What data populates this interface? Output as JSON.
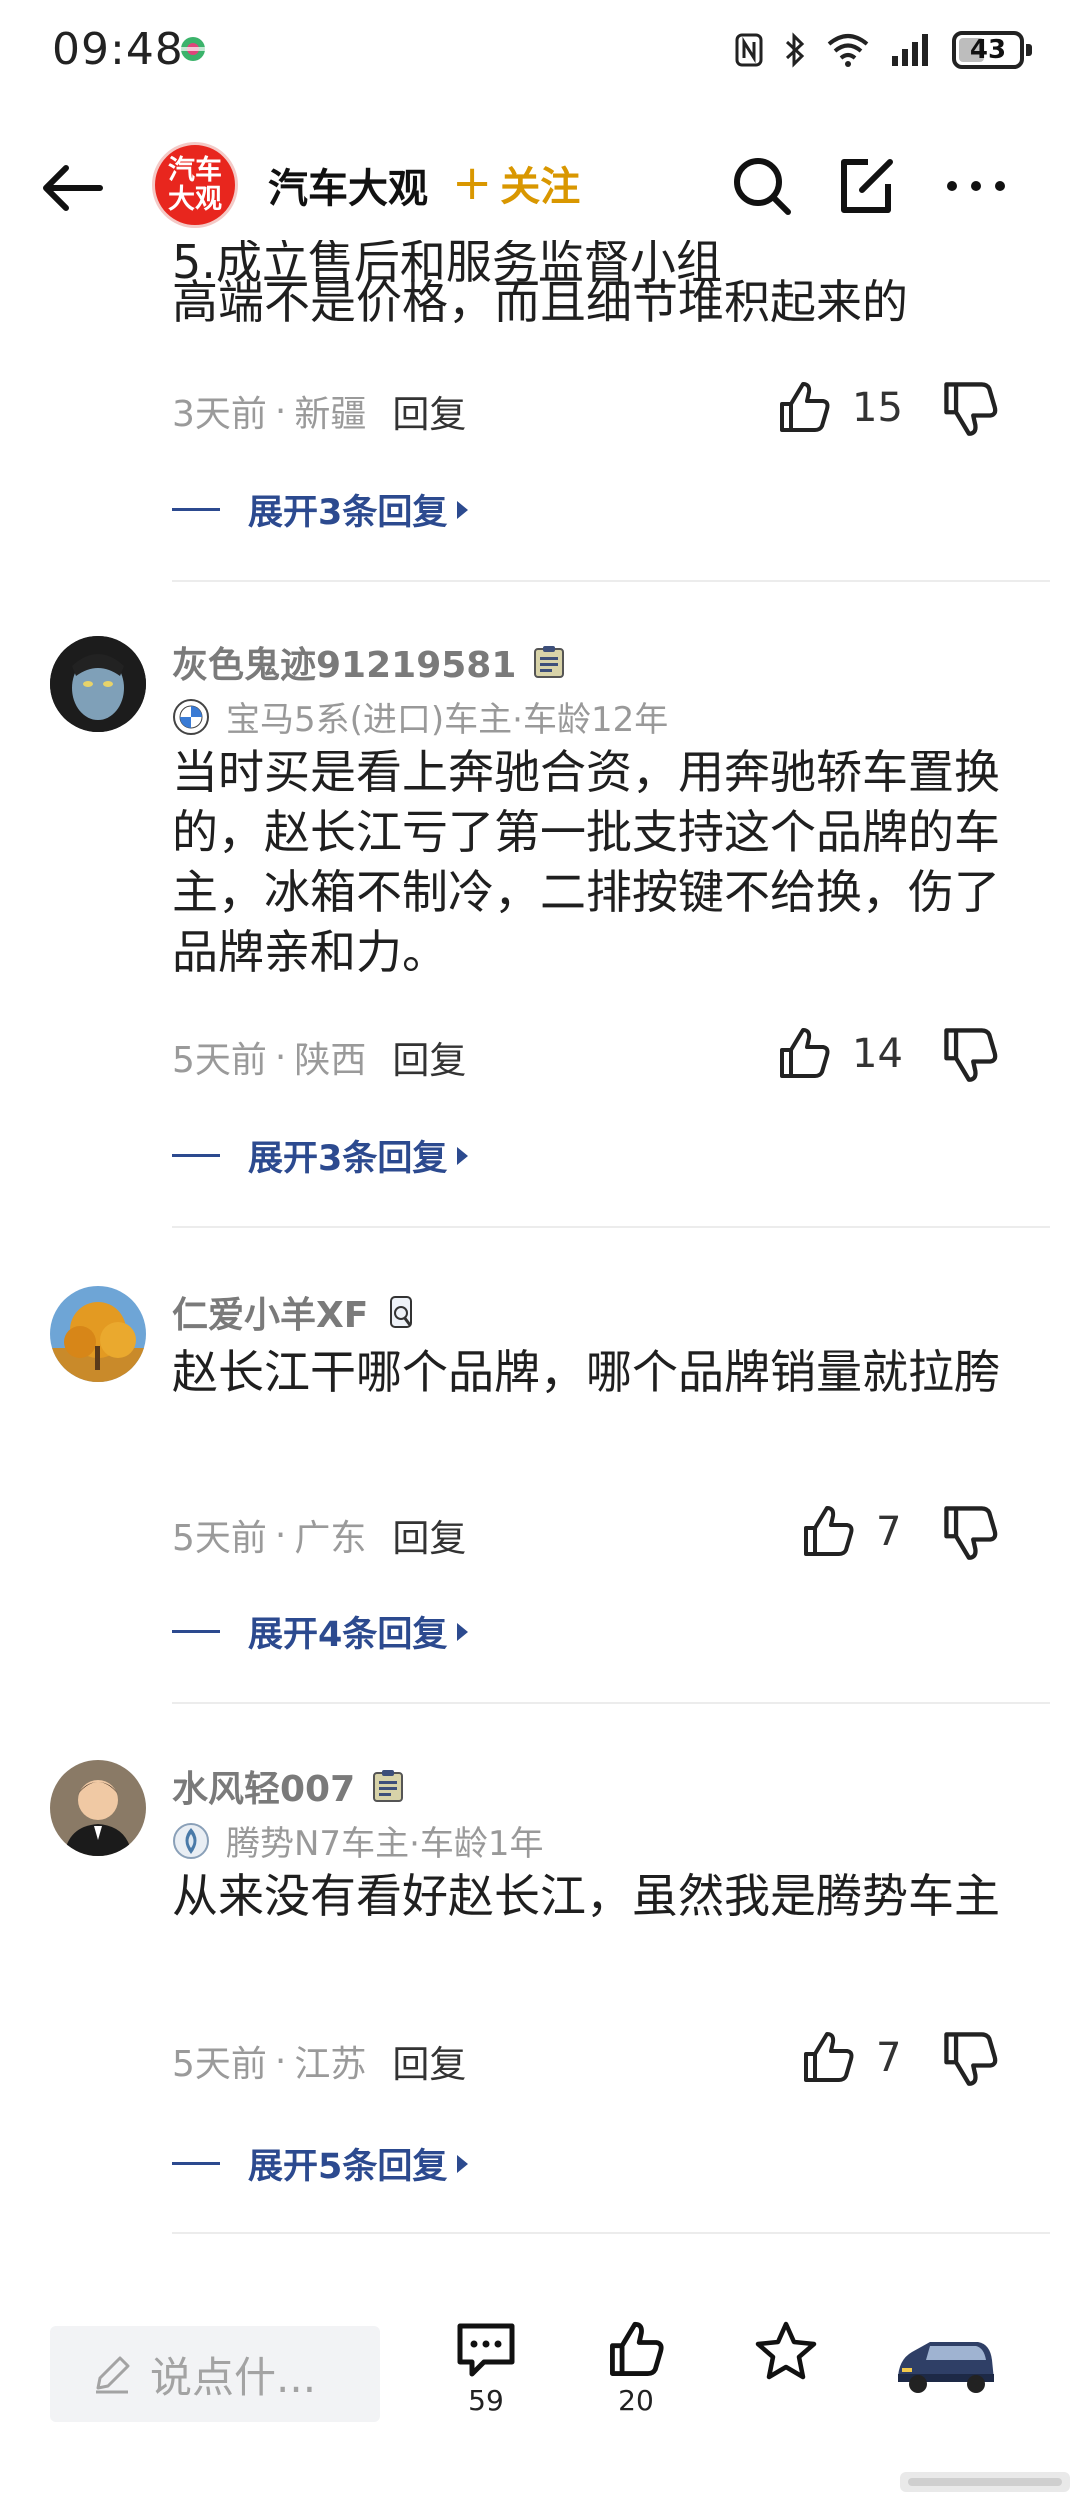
{
  "status_bar": {
    "time": "09:48",
    "battery": "43",
    "battery_level": 0.43
  },
  "nav": {
    "logo_line1": "汽车",
    "logo_line2": "大观",
    "account_name": "汽车大观",
    "follow_label": "关注",
    "brand_color": "#e8261e",
    "follow_color": "#d99700"
  },
  "top_comment": {
    "cut_line": "5.成立售后和服务监督小组",
    "text": "高端不是价格，而且细节堆积起来的",
    "time": "3天前",
    "sep": "·",
    "location": "新疆",
    "reply_label": "回复",
    "likes": "15",
    "expand_label": "展开3条回复"
  },
  "comments": [
    {
      "username": "灰色鬼迹91219581",
      "car_info": "宝马5系(进口)车主·车龄12年",
      "text": "当时买是看上奔驰合资，用奔驰轿车置换的，赵长江亏了第一批支持这个品牌的车主，冰箱不制冷，二排按键不给换，伤了品牌亲和力。",
      "time": "5天前",
      "sep": "·",
      "location": "陕西",
      "reply_label": "回复",
      "likes": "14",
      "expand_label": "展开3条回复"
    },
    {
      "username": "仁爱小羊XF",
      "text": "赵长江干哪个品牌，哪个品牌销量就拉胯",
      "time": "5天前",
      "sep": "·",
      "location": "广东",
      "reply_label": "回复",
      "likes": "7",
      "expand_label": "展开4条回复"
    },
    {
      "username": "水风轻007",
      "car_info": "腾势N7车主·车龄1年",
      "text": "从来没有看好赵长江，虽然我是腾势车主",
      "time": "5天前",
      "sep": "·",
      "location": "江苏",
      "reply_label": "回复",
      "likes": "7",
      "expand_label": "展开5条回复"
    }
  ],
  "bottom_bar": {
    "input_placeholder": "说点什...",
    "comments_count": "59",
    "likes_count": "20"
  },
  "accent_color": "#2c4a8f"
}
